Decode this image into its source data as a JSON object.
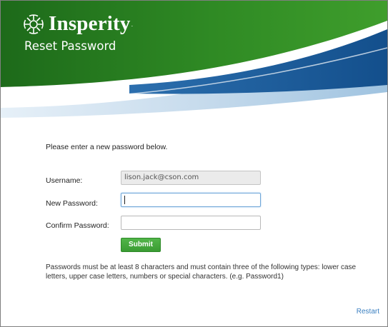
{
  "header": {
    "brand": "Insperity",
    "trademark": ".",
    "title": "Reset Password",
    "colors": {
      "green_dark": "#1f6e1c",
      "green": "#3c9a2a",
      "blue": "#1a5a9a",
      "light_blue": "#bcd8ee"
    }
  },
  "form": {
    "instruction": "Please enter a new password below.",
    "username_label": "Username:",
    "username_value": "lison.jack@cson.com",
    "new_password_label": "New Password:",
    "new_password_value": "",
    "confirm_password_label": "Confirm Password:",
    "confirm_password_value": "",
    "submit_label": "Submit",
    "submit_color": "#44a83c"
  },
  "password_rules": "Passwords must be at least 8 characters and must contain three of the following types: lower case letters, upper case letters, numbers or special characters. (e.g. Password1)",
  "footer": {
    "restart_label": "Restart",
    "link_color": "#3a7fc0"
  }
}
